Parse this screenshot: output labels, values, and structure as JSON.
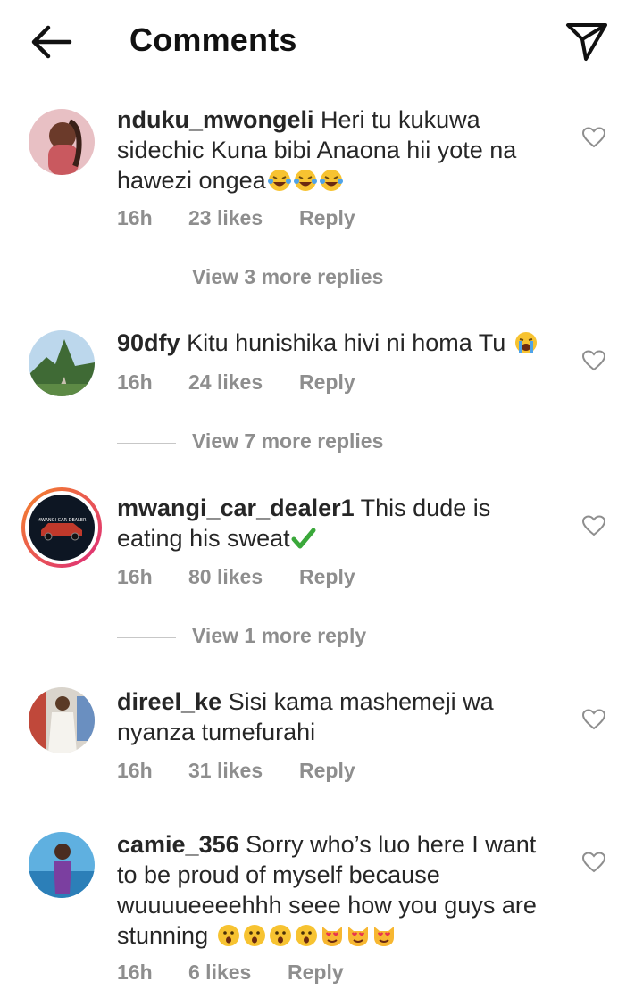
{
  "header": {
    "title": "Comments",
    "back_icon": "arrow-left-icon",
    "share_icon": "paper-plane-icon"
  },
  "comments": [
    {
      "username": "nduku_mwongeli",
      "text": "Heri tu kukuwa sidechic Kuna bibi  Anaona hii yote na hawezi ongea",
      "emojis": [
        "😂",
        "😂",
        "😂"
      ],
      "time": "16h",
      "likes": "23 likes",
      "reply": "Reply",
      "view_replies": "View 3 more replies"
    },
    {
      "username": "90dfy",
      "text": "Kitu hunishika hivi ni homa Tu",
      "emojis": [
        "😭"
      ],
      "time": "16h",
      "likes": "24 likes",
      "reply": "Reply",
      "view_replies": "View 7 more replies"
    },
    {
      "username": "mwangi_car_dealer1",
      "text": "This dude is eating his sweat",
      "emojis": [
        "✅"
      ],
      "time": "16h",
      "likes": "80 likes",
      "reply": "Reply",
      "view_replies": "View 1 more reply",
      "avatar_logo_text": "MWANGI CAR DEALER"
    },
    {
      "username": "direel_ke",
      "text": "Sisi kama mashemeji wa nyanza tumefurahi",
      "emojis": [],
      "time": "16h",
      "likes": "31 likes",
      "reply": "Reply"
    },
    {
      "username": "camie_356",
      "text": "Sorry who’s luo here I want to be proud of myself because wuuuueeeehhh seee how you guys are stunning",
      "emojis": [
        "😮",
        "😮",
        "😮",
        "😮",
        "😻",
        "😻",
        "😻"
      ],
      "time": "16h",
      "likes": "6 likes",
      "reply": "Reply"
    }
  ],
  "colors": {
    "text": "#262626",
    "meta": "#8e8e8e",
    "story_ring_start": "#f58529",
    "story_ring_end": "#dd2a7b"
  }
}
